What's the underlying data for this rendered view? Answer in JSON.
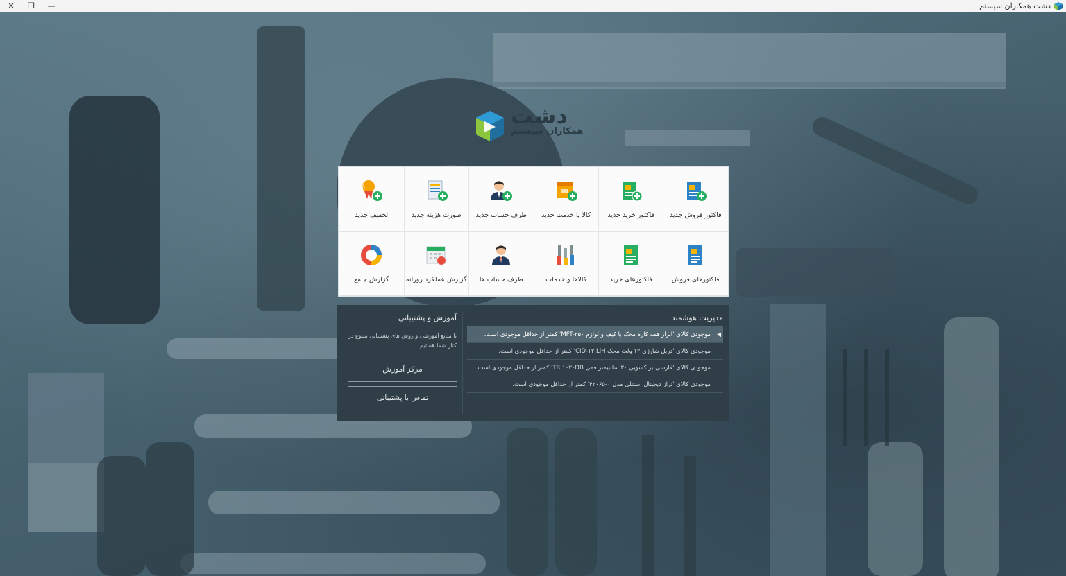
{
  "window": {
    "title": "دشت همکاران سیستم",
    "close": "✕",
    "restore": "❐",
    "minimize": "—"
  },
  "logo": {
    "main": "دشت",
    "sub": "همکاران سیستم"
  },
  "tiles": [
    {
      "label": "فاکتور فروش جدید",
      "icon": "sales-invoice-add-icon"
    },
    {
      "label": "فاکتور خرید جدید",
      "icon": "purchase-invoice-add-icon"
    },
    {
      "label": "کالا یا خدمت جدید",
      "icon": "product-add-icon"
    },
    {
      "label": "طرف حساب جدید",
      "icon": "account-add-icon"
    },
    {
      "label": "صورت هزینه جدید",
      "icon": "expense-add-icon"
    },
    {
      "label": "تخفیف جدید",
      "icon": "discount-add-icon"
    },
    {
      "label": "فاکتورهای فروش",
      "icon": "sales-invoices-icon"
    },
    {
      "label": "فاکتورهای خرید",
      "icon": "purchase-invoices-icon"
    },
    {
      "label": "کالاها و خدمات",
      "icon": "tools-icon"
    },
    {
      "label": "طرف حساب ها",
      "icon": "accounts-icon"
    },
    {
      "label": "گزارش عملکرد روزانه",
      "icon": "daily-report-icon"
    },
    {
      "label": "گزارش جامع",
      "icon": "comprehensive-report-icon"
    }
  ],
  "smart": {
    "title": "مدیریت هوشمند",
    "items": [
      "موجودی کالای  'ابزار همه کاره محک با کیف و لوازم MFT-۲۵۰'  کمتر از حداقل موجودی است.",
      "موجودی کالای  'دریل شارژی ۱۲ ولت محک CID-۱۲ LiH'  کمتر از حداقل موجودی است.",
      "موجودی کالای  'فارسی بر کشویی ۳۰ سانتیمتر فمی TR ۱۰۳۰DB'  کمتر از حداقل موجودی است.",
      "موجودی کالای  'تراز دیجیتال استنلی مدل ۰-۴۲۰۶۵'  کمتر از حداقل موجودی است."
    ]
  },
  "support": {
    "title": "آموزش  و  پشتیبانی",
    "desc": "با منابع آموزشی و روش های پشتیبانی متنوع در کنار شما هستیم.",
    "training_label": "مرکز آموزش",
    "contact_label": "تماس با پشتیبانی"
  }
}
